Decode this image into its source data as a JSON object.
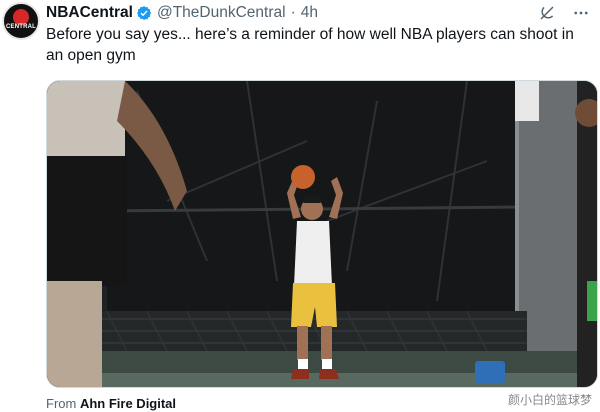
{
  "account": {
    "display_name": "NBACentral",
    "handle": "@TheDunkCentral",
    "separator": "·",
    "time": "4h",
    "avatar_text": "CENTRAL",
    "verified_color": "#1d9bf0"
  },
  "tweet": {
    "text": "Before you say yes... here’s a reminder of how well NBA players can shoot in an open gym"
  },
  "source": {
    "prefix": "From",
    "name": "Ahn Fire Digital"
  },
  "watermark": "颜小白的篮球梦",
  "icons": [
    "grok-icon",
    "more-icon",
    "verified-badge-icon"
  ],
  "colors": {
    "text_primary": "#0f1419",
    "text_secondary": "#536471",
    "shorts": "#e9c13f",
    "brand_red": "#d62828"
  }
}
